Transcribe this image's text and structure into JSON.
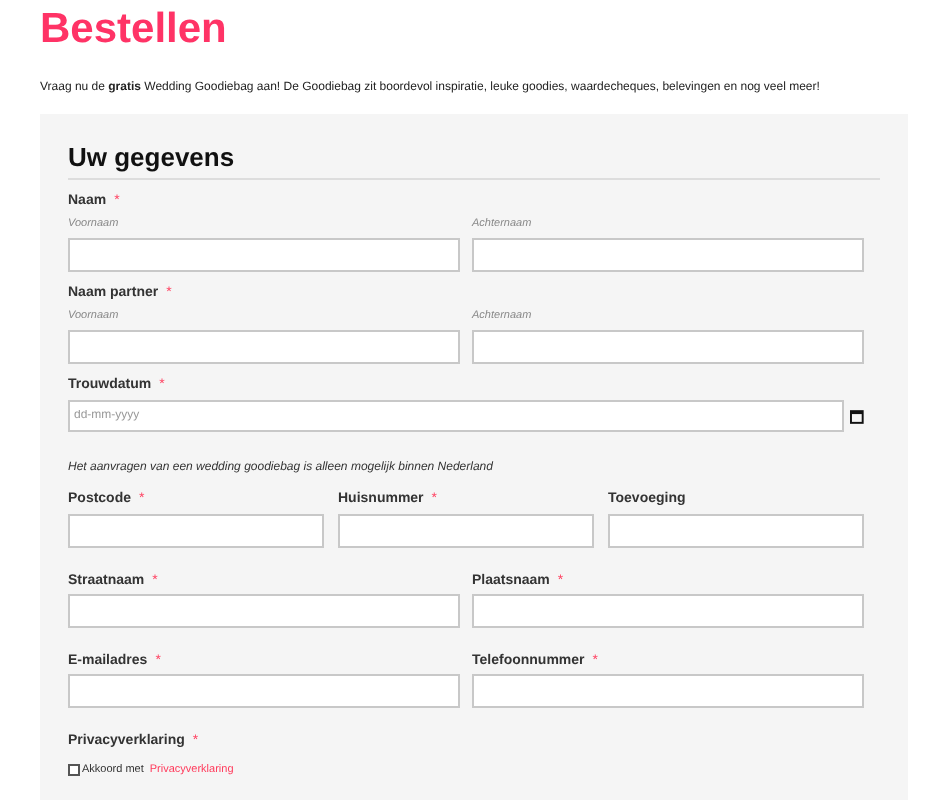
{
  "title": "Bestellen",
  "intro": "Vraag nu de **gratis** Wedding Goodiebag aan! De Goodiebag zit boordevol inspiratie, leuke goodies, waardecheques, belevingen en nog veel meer!",
  "form": {
    "heading": "Uw gegevens",
    "sections": [
      {
        "kind": "name",
        "label": "Naam",
        "required_mark": "*",
        "sublabels": [
          "Voornaam",
          "Achternaam"
        ]
      },
      {
        "kind": "name",
        "label": "Naam partner",
        "required_mark": "*",
        "sublabels": [
          "Voornaam",
          "Achternaam"
        ]
      },
      {
        "kind": "date",
        "label": "Trouwdatum",
        "required_mark": "*",
        "placeholder": "dd-mm-yyyy"
      },
      {
        "kind": "note",
        "text": "Het aanvragen van een wedding goodiebag is alleen mogelijk binnen Nederland"
      },
      {
        "kind": "row",
        "fields": [
          {
            "label": "Postcode",
            "required_mark": "*"
          },
          {
            "label": "Huisnummer",
            "required_mark": "*"
          },
          {
            "label": "Toevoeging"
          }
        ]
      },
      {
        "kind": "row",
        "fields": [
          {
            "label": "Straatnaam",
            "required_mark": "*"
          },
          {
            "label": "Plaatsnaam",
            "required_mark": "*"
          }
        ]
      },
      {
        "kind": "row",
        "fields": [
          {
            "label": "E-mailadres",
            "required_mark": "*"
          },
          {
            "label": "Telefoonnummer",
            "required_mark": "*"
          }
        ]
      },
      {
        "kind": "consent",
        "label": "Privacyverklaring",
        "required_mark": "*",
        "checked": false,
        "text": "Akkoord met",
        "link": "Privacyverklaring"
      }
    ]
  }
}
